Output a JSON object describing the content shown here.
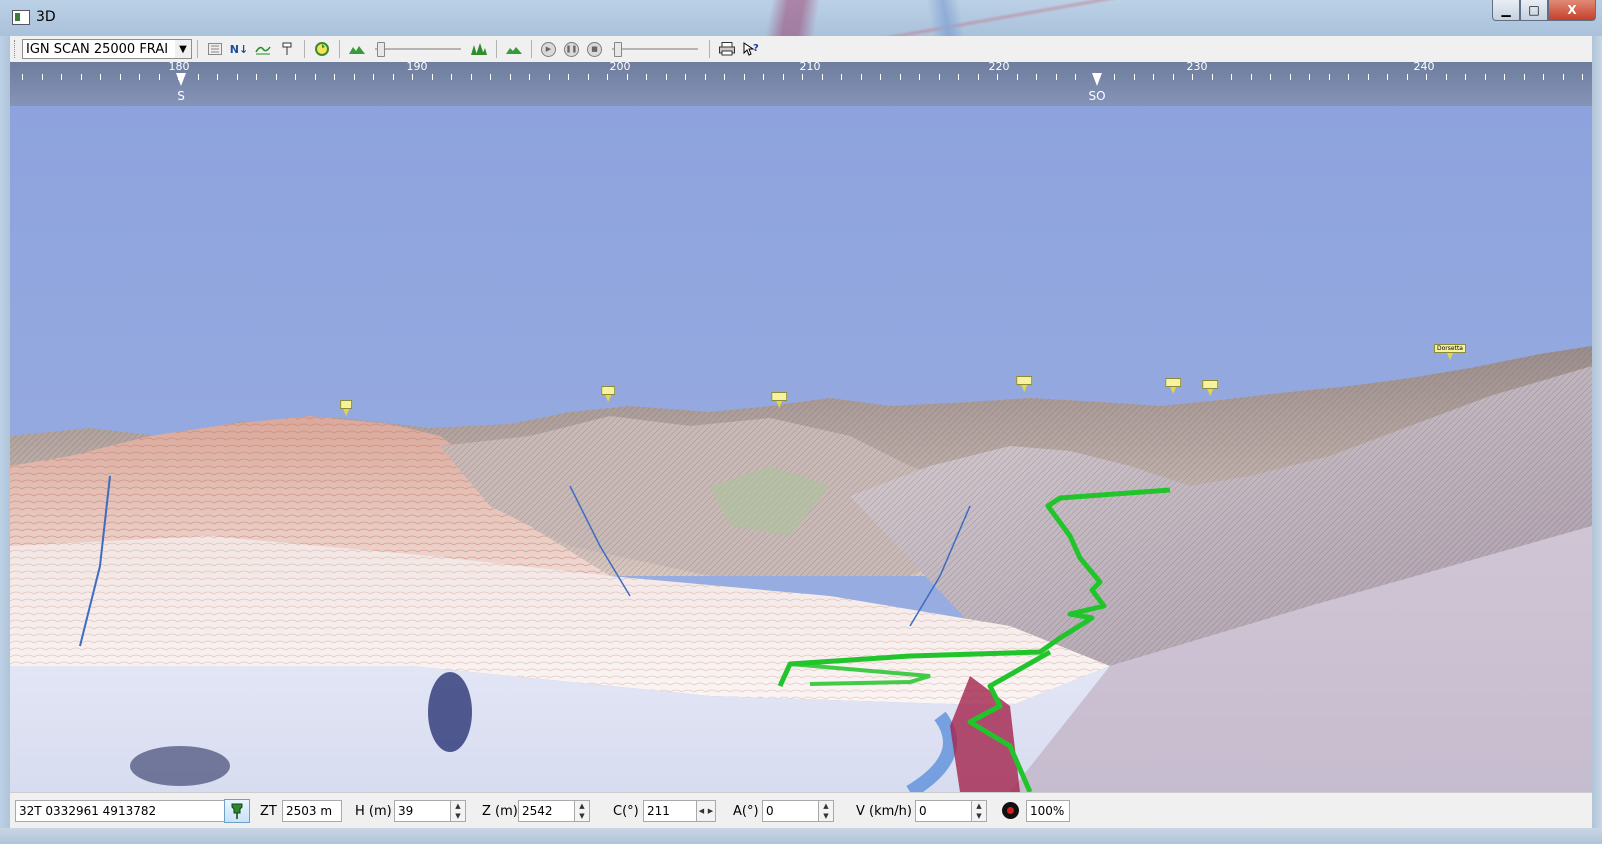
{
  "window": {
    "title": "3D",
    "minimize_glyph": "▁",
    "maximize_glyph": "□",
    "close_glyph": "X"
  },
  "toolbar": {
    "map_layer": "IGN SCAN 25000 FRAI",
    "north_label": "N↓",
    "icons": [
      "map-grid-icon",
      "north-up-icon",
      "contours-icon",
      "marker-icon",
      "refresh-icon",
      "terrain-icon",
      "peaks-icon",
      "terrain-small-icon",
      "play-icon",
      "pause-icon",
      "stop-icon",
      "print-icon",
      "help-icon"
    ]
  },
  "compass": {
    "degrees": [
      "180",
      "190",
      "200",
      "210",
      "220",
      "230",
      "240"
    ],
    "cardinals": [
      "S",
      "SO"
    ]
  },
  "summits": {
    "dorsetta": "Dorsetta"
  },
  "status": {
    "coords": "32T  0332961  4913782",
    "zt_label": "ZT",
    "zt_value": "2503 m",
    "h_label": "H (m)",
    "h_value": "39",
    "z_label": "Z (m)",
    "z_value": "2542",
    "c_label": "C(°)",
    "c_value": "211",
    "a_label": "A(°)",
    "a_value": "0",
    "v_label": "V (km/h)",
    "v_value": "0",
    "zoom_value": "100%"
  },
  "colors": {
    "sky_top": "#8ea3dd",
    "sky_horizon": "#9bb0e2",
    "track": "#22c42b",
    "compass_bg": "#7484a6"
  }
}
